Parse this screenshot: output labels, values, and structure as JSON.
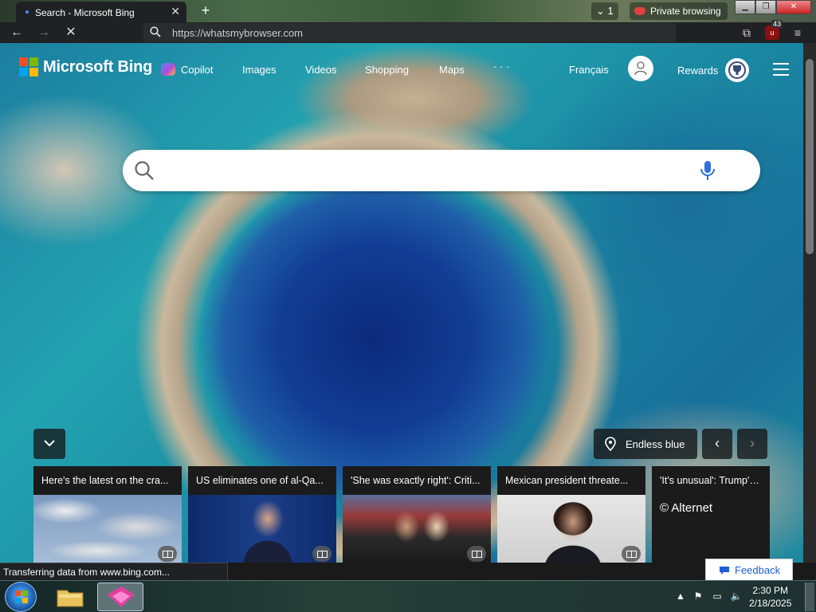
{
  "browser": {
    "tab_title": "Search - Microsoft Bing",
    "tab_count": "1",
    "private_label": "Private browsing",
    "url": "https://whatsmybrowser.com",
    "ublock_count": "43"
  },
  "bing": {
    "brand": "Microsoft Bing",
    "nav": [
      "Copilot",
      "Images",
      "Videos",
      "Shopping",
      "Maps",
      "· · ·"
    ],
    "language": "Français",
    "rewards": "Rewards",
    "location_label": "Endless blue",
    "news": [
      {
        "headline": "Here's the latest on the cra..."
      },
      {
        "headline": "US eliminates one of al-Qa..."
      },
      {
        "headline": "'She was exactly right': Criti..."
      },
      {
        "headline": "Mexican president threate..."
      },
      {
        "headline": "'It's unusual': Trump's DG"
      }
    ],
    "alternet_label": "© Alternet",
    "feedback_label": "Feedback"
  },
  "status_text": "Transferring data from www.bing.com...",
  "taskbar": {
    "time": "2:30 PM",
    "date": "2/18/2025"
  },
  "colors": {
    "tab_bg": "#202124",
    "feedback_text": "#1e5ed6",
    "ublock_red": "#8a1010"
  }
}
